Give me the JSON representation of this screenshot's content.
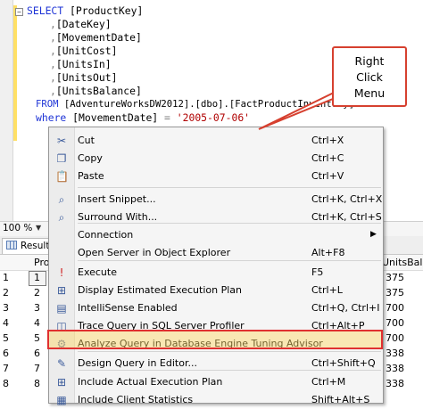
{
  "editor": {
    "collapse_glyph": "−",
    "lines": {
      "l1_kw": "SELECT ",
      "l1_id": "[ProductKey]",
      "l2_pn": ",",
      "l2_id": "[DateKey]",
      "l3_pn": ",",
      "l3_id": "[MovementDate]",
      "l4_pn": ",",
      "l4_id": "[UnitCost]",
      "l5_pn": ",",
      "l5_id": "[UnitsIn]",
      "l6_pn": ",",
      "l6_id": "[UnitsOut]",
      "l7_pn": ",",
      "l7_id": "[UnitsBalance]",
      "l8_kw": "FROM ",
      "l8_id": "[AdventureWorksDW2012].[dbo].[FactProductInventory]",
      "l9_kw": "where ",
      "l9_id": "[MovementDate] ",
      "l9_pn": "= ",
      "l9_str": "'2005-07-06'"
    }
  },
  "zoom": {
    "value": "100 %"
  },
  "results": {
    "tab_label": "Results",
    "col_prod": "Pro",
    "col_units": "UnitsBala",
    "row_numbers": [
      "1",
      "2",
      "3",
      "4",
      "5",
      "6",
      "7",
      "8"
    ],
    "first_col": [
      "1",
      "2",
      "3",
      "4",
      "5",
      "6",
      "7",
      "8"
    ],
    "last_col": [
      "375",
      "375",
      "700",
      "700",
      "700",
      "338",
      "338",
      "338"
    ]
  },
  "menu": {
    "items": [
      {
        "label": "Cut",
        "shortcut": "Ctrl+X",
        "icon": "scissors-icon"
      },
      {
        "label": "Copy",
        "shortcut": "Ctrl+C",
        "icon": "copy-icon"
      },
      {
        "label": "Paste",
        "shortcut": "Ctrl+V",
        "icon": "paste-icon"
      },
      {
        "label": "Insert Snippet...",
        "shortcut": "Ctrl+K, Ctrl+X",
        "icon": "snippet-icon"
      },
      {
        "label": "Surround With...",
        "shortcut": "Ctrl+K, Ctrl+S",
        "icon": "surround-icon"
      },
      {
        "label": "Connection",
        "shortcut": "",
        "icon": ""
      },
      {
        "label": "Open Server in Object Explorer",
        "shortcut": "Alt+F8",
        "icon": ""
      },
      {
        "label": "Execute",
        "shortcut": "F5",
        "icon": "execute-icon"
      },
      {
        "label": "Display Estimated Execution Plan",
        "shortcut": "Ctrl+L",
        "icon": "plan-icon"
      },
      {
        "label": "IntelliSense Enabled",
        "shortcut": "Ctrl+Q, Ctrl+I",
        "icon": "intellisense-icon"
      },
      {
        "label": "Trace Query in SQL Server Profiler",
        "shortcut": "Ctrl+Alt+P",
        "icon": "trace-icon"
      },
      {
        "label": "Analyze Query in Database Engine Tuning Advisor",
        "shortcut": "",
        "icon": "tuning-advisor-icon"
      },
      {
        "label": "Design Query in Editor...",
        "shortcut": "Ctrl+Shift+Q",
        "icon": "design-query-icon"
      },
      {
        "label": "Include Actual Execution Plan",
        "shortcut": "Ctrl+M",
        "icon": "actual-plan-icon"
      },
      {
        "label": "Include Client Statistics",
        "shortcut": "Shift+Alt+S",
        "icon": "client-stats-icon"
      }
    ]
  },
  "callout": {
    "line1": "Right",
    "line2": "Click",
    "line3": "Menu"
  },
  "colors": {
    "highlight_border": "#e03030",
    "callout_border": "#d6402f",
    "keyword": "#1e34d6",
    "string": "#b00000"
  }
}
